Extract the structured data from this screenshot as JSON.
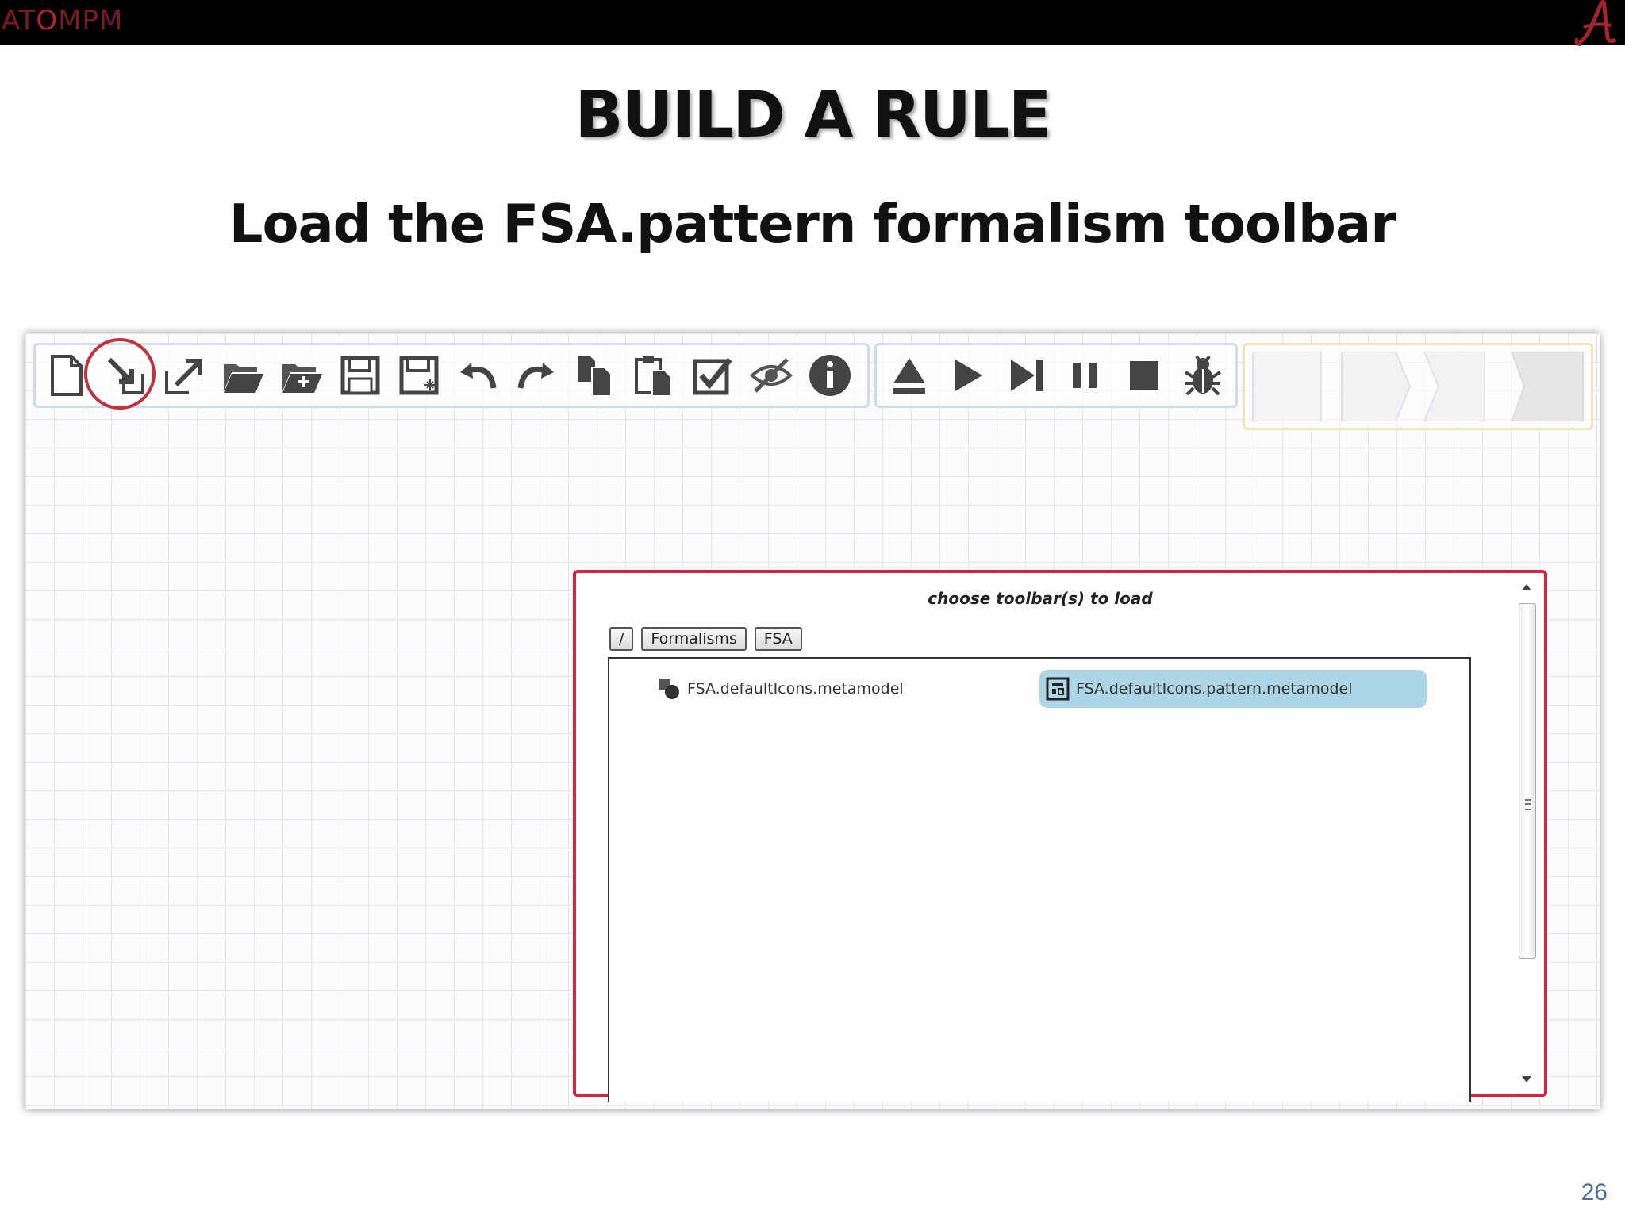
{
  "header": {
    "brand": "AT",
    "brand_o": "O",
    "brand_rest": "MPM"
  },
  "slide": {
    "title": "BUILD A RULE",
    "subtitle": "Load the FSA.pattern formalism toolbar",
    "page_number": "26"
  },
  "toolbar": {
    "icons": [
      "new-file-icon",
      "load-toolbar-icon",
      "export-icon",
      "open-folder-icon",
      "new-folder-icon",
      "save-icon",
      "save-as-icon",
      "undo-icon",
      "redo-icon",
      "copy-icon",
      "paste-icon",
      "validate-icon",
      "hide-icon",
      "info-icon"
    ],
    "transform_icons": [
      "load-transformation-icon",
      "play-icon",
      "step-icon",
      "pause-icon",
      "stop-icon",
      "debug-bug-icon"
    ]
  },
  "dialog": {
    "title": "choose toolbar(s) to load",
    "breadcrumbs": [
      "/",
      "Formalisms",
      "FSA"
    ],
    "files": [
      {
        "name": "FSA.defaultIcons.metamodel",
        "selected": false
      },
      {
        "name": "FSA.defaultIcons.pattern.metamodel",
        "selected": true
      }
    ]
  },
  "colors": {
    "dialog_border": "#d4253e",
    "selection": "#acd6e6",
    "highlight_ring": "#c0323d"
  }
}
